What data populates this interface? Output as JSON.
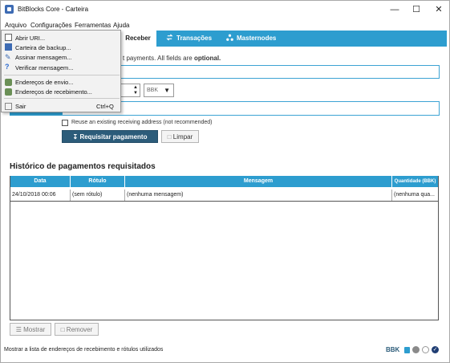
{
  "window": {
    "title": "BitBlocks Core - Carteira"
  },
  "menubar": [
    "Arquivo",
    "Configurações",
    "Ferramentas",
    "Ajuda"
  ],
  "tabs": {
    "receive": "Receber",
    "transactions": "Transações",
    "masternodes": "Masternodes"
  },
  "form": {
    "intro_text": "t payments. All fields are ",
    "intro_bold": "optional.",
    "unit": "BBK",
    "reuse_label": "Reuse an existing receiving address (not recommended)",
    "request_button": "Requisitar pagamento",
    "clear_button": "Limpar"
  },
  "history": {
    "title": "Histórico de pagamentos requisitados",
    "columns": [
      "Data",
      "Rótulo",
      "Mensagem",
      "Quantidade (BBK)"
    ],
    "rows": [
      {
        "date": "24/10/2018 00:06",
        "label": "(sem rótulo)",
        "message": "(nenhuma mensagem)",
        "amount": "(nenhuma qua..."
      }
    ],
    "show_button": "Mostrar",
    "remove_button": "Remover"
  },
  "status_bar": {
    "text": "Mostrar a lista de endereços de recebimento e rótulos utilizados",
    "unit": "BBK"
  },
  "file_menu": {
    "items": [
      {
        "label": "Abrir URI...",
        "icon": "open-uri-icon"
      },
      {
        "label": "Carteira de backup...",
        "icon": "backup-icon"
      },
      {
        "label": "Assinar mensagem...",
        "icon": "sign-icon"
      },
      {
        "label": "Verificar mensagem...",
        "icon": "verify-icon"
      },
      {
        "label": "Endereços de envio...",
        "icon": "address-book-icon"
      },
      {
        "label": "Endereços de recebimento...",
        "icon": "address-book-icon"
      },
      {
        "label": "Sair",
        "shortcut": "Ctrl+Q",
        "icon": "exit-icon"
      }
    ]
  },
  "colors": {
    "accent": "#2d9dcf",
    "primary_button": "#2c5c7a",
    "menu_highlight": "#cde4f7"
  }
}
